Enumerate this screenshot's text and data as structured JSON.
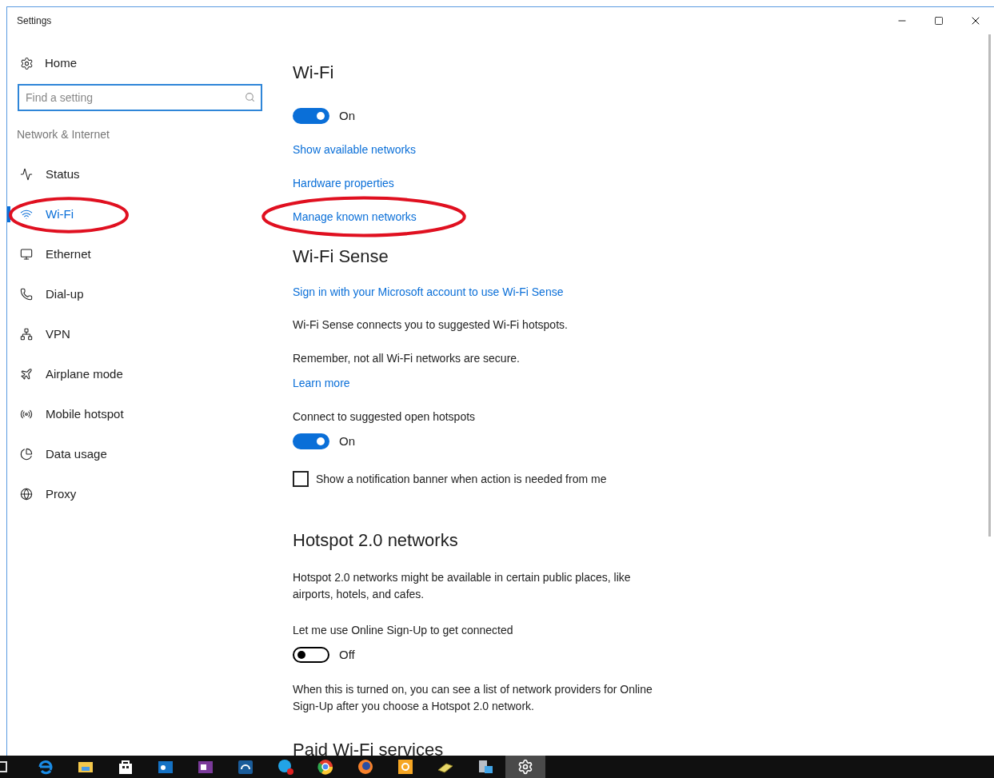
{
  "window": {
    "title": "Settings"
  },
  "sidebar": {
    "home": {
      "label": "Home"
    },
    "search": {
      "placeholder": "Find a setting"
    },
    "section": "Network & Internet",
    "items": [
      {
        "label": "Status",
        "selected": false,
        "circled": false
      },
      {
        "label": "Wi-Fi",
        "selected": true,
        "circled": true
      },
      {
        "label": "Ethernet",
        "selected": false,
        "circled": false
      },
      {
        "label": "Dial-up",
        "selected": false,
        "circled": false
      },
      {
        "label": "VPN",
        "selected": false,
        "circled": false
      },
      {
        "label": "Airplane mode",
        "selected": false,
        "circled": false
      },
      {
        "label": "Mobile hotspot",
        "selected": false,
        "circled": false
      },
      {
        "label": "Data usage",
        "selected": false,
        "circled": false
      },
      {
        "label": "Proxy",
        "selected": false,
        "circled": false
      }
    ]
  },
  "content": {
    "blocks": [
      {
        "kind": "heading",
        "text": "Wi-Fi"
      },
      {
        "kind": "toggle",
        "on": true,
        "label": "On"
      },
      {
        "kind": "link",
        "text": "Show available networks"
      },
      {
        "kind": "link",
        "text": "Hardware properties"
      },
      {
        "kind": "link",
        "text": "Manage known networks",
        "circled": true
      },
      {
        "kind": "heading",
        "text": "Wi-Fi Sense"
      },
      {
        "kind": "link",
        "text": "Sign in with your Microsoft account to use Wi-Fi Sense",
        "circled": false
      },
      {
        "kind": "text",
        "text": "Wi-Fi Sense connects you to suggested Wi-Fi hotspots."
      },
      {
        "kind": "text",
        "text": "Remember, not all Wi-Fi networks are secure."
      },
      {
        "kind": "link",
        "text": "Learn more"
      },
      {
        "kind": "text",
        "text": "Connect to suggested open hotspots"
      },
      {
        "kind": "toggle",
        "on": true,
        "label": "On"
      },
      {
        "kind": "checkbox",
        "checked": false,
        "label": "Show a notification banner when action is needed from me"
      },
      {
        "kind": "heading",
        "text": "Hotspot 2.0 networks"
      },
      {
        "kind": "text",
        "text": "Hotspot 2.0 networks might be available in certain public places, like airports, hotels, and cafes."
      },
      {
        "kind": "text",
        "text": "Let me use Online Sign-Up to get connected"
      },
      {
        "kind": "toggle",
        "on": false,
        "label": "Off"
      },
      {
        "kind": "text",
        "text": "When this is turned on, you can see a list of network providers for Online Sign-Up after you choose a Hotspot 2.0 network."
      },
      {
        "kind": "heading",
        "text": "Paid Wi-Fi services"
      }
    ]
  },
  "taskbar": {
    "apps": [
      {
        "selected": false
      },
      {
        "selected": false
      },
      {
        "selected": false
      },
      {
        "selected": false
      },
      {
        "selected": false
      },
      {
        "selected": false
      },
      {
        "selected": false
      },
      {
        "selected": false
      },
      {
        "selected": false
      },
      {
        "selected": false
      },
      {
        "selected": false
      },
      {
        "selected": false
      },
      {
        "selected": false
      },
      {
        "selected": true
      }
    ]
  }
}
